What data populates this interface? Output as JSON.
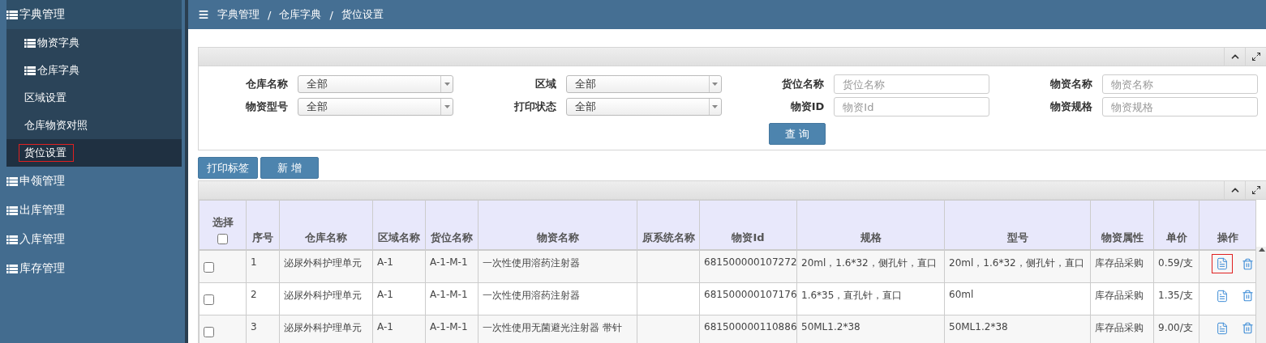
{
  "sidebar": {
    "items": [
      {
        "label": "字典管理",
        "expanded": true,
        "children": [
          {
            "label": "物资字典",
            "kind": "icon",
            "selected": false
          },
          {
            "label": "仓库字典",
            "kind": "icon",
            "selected": false
          },
          {
            "label": "区域设置",
            "kind": "plain",
            "selected": false
          },
          {
            "label": "仓库物资对照",
            "kind": "plain",
            "selected": false
          },
          {
            "label": "货位设置",
            "kind": "plain",
            "selected": true
          }
        ]
      },
      {
        "label": "申领管理",
        "expanded": false
      },
      {
        "label": "出库管理",
        "expanded": false
      },
      {
        "label": "入库管理",
        "expanded": false
      },
      {
        "label": "库存管理",
        "expanded": false
      }
    ]
  },
  "breadcrumb": [
    "字典管理",
    "/",
    "仓库字典",
    "/",
    "货位设置"
  ],
  "filters": [
    {
      "label": "仓库名称",
      "kind": "select",
      "value": "全部"
    },
    {
      "label": "区域",
      "kind": "select",
      "value": "全部"
    },
    {
      "label": "货位名称",
      "kind": "text",
      "placeholder": "货位名称"
    },
    {
      "label": "物资名称",
      "kind": "text",
      "placeholder": "物资名称"
    },
    {
      "label": "物资型号",
      "kind": "select",
      "value": "全部"
    },
    {
      "label": "打印状态",
      "kind": "select",
      "value": "全部"
    },
    {
      "label": "物资ID",
      "kind": "text",
      "placeholder": "物资Id"
    },
    {
      "label": "物资规格",
      "kind": "text",
      "placeholder": "物资规格"
    }
  ],
  "query_button": "查 询",
  "toolbar_buttons": [
    "打印标签",
    "新 增"
  ],
  "table": {
    "columns": [
      "选择",
      "序号",
      "仓库名称",
      "区域名称",
      "货位名称",
      "物资名称",
      "原系统名称",
      "物资Id",
      "规格",
      "型号",
      "物资属性",
      "单价",
      "操作"
    ],
    "select_all_checked": false,
    "rows": [
      {
        "checked": false,
        "marked": true,
        "cells": [
          "",
          "1",
          "泌尿外科护理单元",
          "A-1",
          "A-1-M-1",
          "一次性使用溶药注射器",
          "",
          "681500000107272",
          "20ml，1.6*32，侧孔针，直口",
          "20ml，1.6*32，侧孔针，直口",
          "库存品采购",
          "0.59/支"
        ]
      },
      {
        "checked": false,
        "marked": false,
        "cells": [
          "",
          "2",
          "泌尿外科护理单元",
          "A-1",
          "A-1-M-1",
          "一次性使用溶药注射器",
          "",
          "681500000107176",
          "1.6*35，直孔针，直口",
          "60ml",
          "库存品采购",
          "1.35/支"
        ]
      },
      {
        "checked": false,
        "marked": false,
        "cells": [
          "",
          "3",
          "泌尿外科护理单元",
          "A-1",
          "A-1-M-1",
          "一次性使用无菌避光注射器 带针",
          "",
          "681500000110886",
          "50ML1.2*38",
          "50ML1.2*38",
          "库存品采购",
          "9.00/支"
        ]
      }
    ]
  }
}
